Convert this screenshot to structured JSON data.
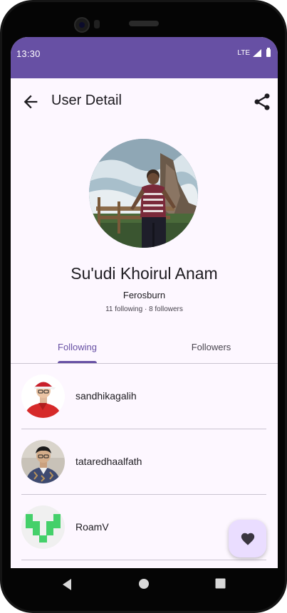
{
  "status_bar": {
    "time": "13:30",
    "network": "LTE",
    "signal_icon": "signal-icon",
    "battery_icon": "battery-icon"
  },
  "app_bar": {
    "title": "User Detail",
    "back_icon": "arrow-back-icon",
    "share_icon": "share-icon"
  },
  "profile": {
    "name": "Su'udi Khoirul Anam",
    "location": "Ferosburn",
    "stats": "11 following · 8 followers"
  },
  "tabs": [
    {
      "label": "Following",
      "active": true
    },
    {
      "label": "Followers",
      "active": false
    }
  ],
  "users": [
    {
      "username": "sandhikagalih"
    },
    {
      "username": "tataredhaalfath"
    },
    {
      "username": "RoamV"
    }
  ],
  "fab": {
    "icon": "heart-icon"
  },
  "colors": {
    "primary": "#6750a4",
    "surface": "#fdf7ff",
    "fab_container": "#eaddff",
    "divider": "#cac4d0"
  },
  "nav_bar": {
    "back_icon": "nav-back-icon",
    "home_icon": "nav-home-icon",
    "recent_icon": "nav-recent-icon"
  }
}
